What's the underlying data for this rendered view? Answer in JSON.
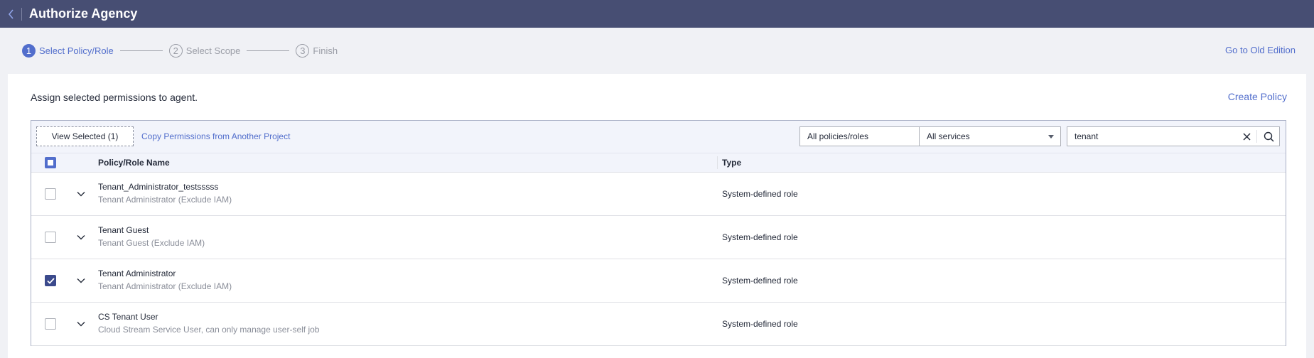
{
  "header": {
    "title": "Authorize Agency"
  },
  "steps": [
    {
      "number": "1",
      "label": "Select Policy/Role",
      "state": "active"
    },
    {
      "number": "2",
      "label": "Select Scope",
      "state": "inactive"
    },
    {
      "number": "3",
      "label": "Finish",
      "state": "inactive"
    }
  ],
  "old_edition_link": "Go to Old Edition",
  "intro_text": "Assign selected permissions to agent.",
  "create_policy_link": "Create Policy",
  "toolbar": {
    "view_selected_label": "View Selected (1)",
    "copy_permissions_label": "Copy Permissions from Another Project",
    "policy_filter": "All policies/roles",
    "service_filter": "All services",
    "search_value": "tenant"
  },
  "table": {
    "col_name": "Policy/Role Name",
    "col_type": "Type",
    "rows": [
      {
        "name": "Tenant_Administrator_testsssss",
        "desc": "Tenant Administrator (Exclude IAM)",
        "type": "System-defined role",
        "checked": false
      },
      {
        "name": "Tenant Guest",
        "desc": "Tenant Guest (Exclude IAM)",
        "type": "System-defined role",
        "checked": false
      },
      {
        "name": "Tenant Administrator",
        "desc": "Tenant Administrator (Exclude IAM)",
        "type": "System-defined role",
        "checked": true
      },
      {
        "name": "CS Tenant User",
        "desc": "Cloud Stream Service User, can only manage user-self job",
        "type": "System-defined role",
        "checked": false
      }
    ]
  },
  "colors": {
    "header_bg": "#474e73",
    "accent": "#526ecc",
    "checked": "#3b4a8c"
  },
  "icons": {
    "back": "chevron-left-icon",
    "expand": "chevron-down-icon",
    "clear": "close-icon",
    "search": "search-icon"
  }
}
